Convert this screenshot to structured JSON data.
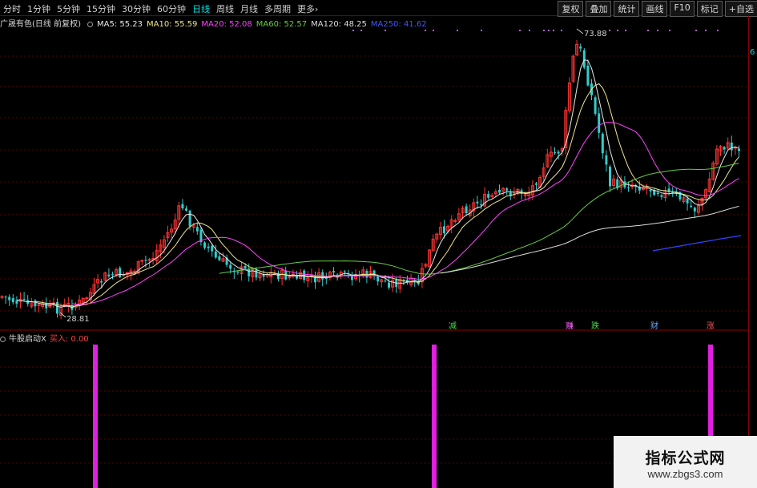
{
  "toolbar": {
    "tabs": [
      "分时",
      "1分钟",
      "5分钟",
      "15分钟",
      "30分钟",
      "60分钟",
      "日线",
      "周线",
      "月线",
      "多周期",
      "更多"
    ],
    "active_tab": "日线",
    "more_suffix": "›",
    "right_buttons": [
      "复权",
      "叠加",
      "统计",
      "画线",
      "F10",
      "标记",
      "+自选"
    ]
  },
  "stock": {
    "name": "广晟有色(日线 前复权)",
    "ma5": "MA5: 55.23",
    "ma10": "MA10: 55.59",
    "ma20": "MA20: 52.08",
    "ma60": "MA60: 52.57",
    "ma120": "MA120: 48.25",
    "ma250": "MA250: 41.62",
    "high_label": "73.88",
    "low_label": "28.81",
    "axis_label": "6"
  },
  "signals": [
    "减",
    "赚",
    "跌",
    "财",
    "涨"
  ],
  "sub_indicator": {
    "name": "牛股启动X",
    "label": "买入: 0.00"
  },
  "colors": {
    "ma5": "#e8e8e8",
    "ma10": "#f0e68c",
    "ma20": "#ff44ff",
    "ma60": "#66cc44",
    "ma120": "#dddddd",
    "ma250": "#3344ff",
    "up": "#ff3333",
    "down": "#33cccc",
    "signal_bar": "#e020e0"
  },
  "watermark": {
    "line1": "指标公式网",
    "line2": "www.zbgs3.com"
  }
}
